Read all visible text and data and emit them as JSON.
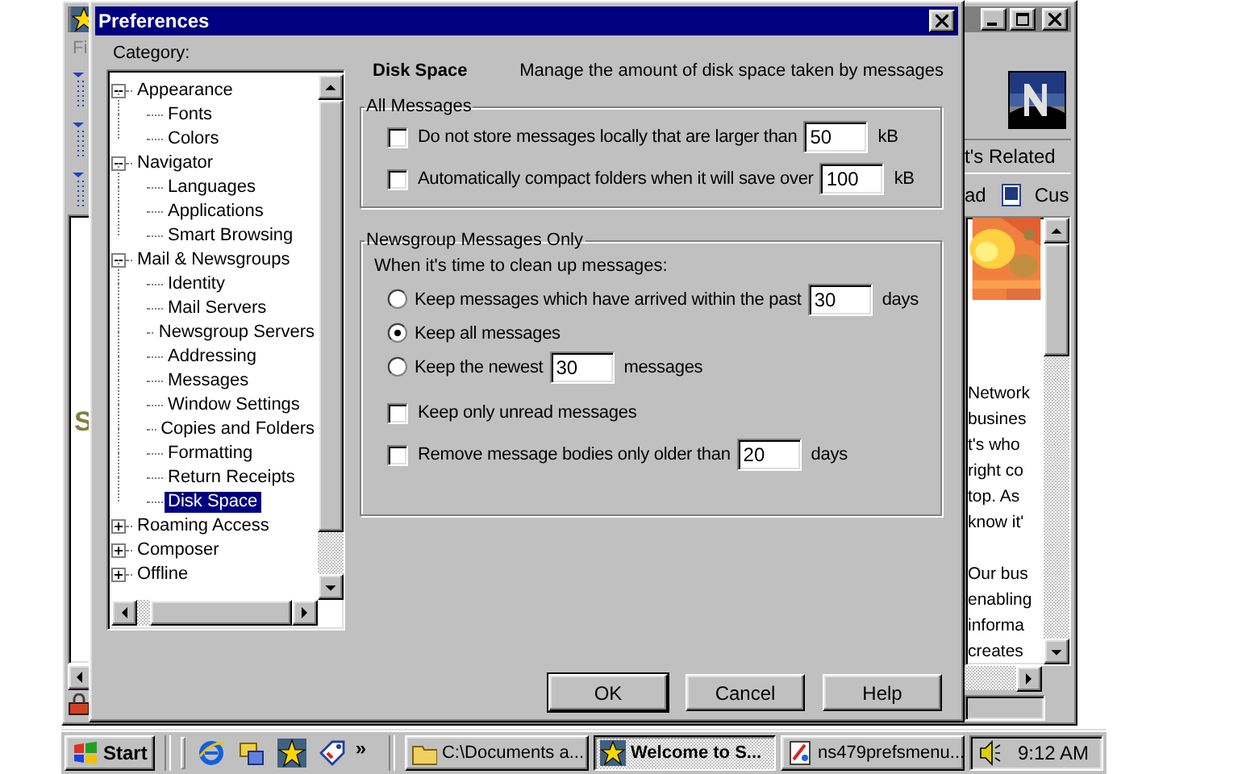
{
  "browser_window": {
    "menu_partial": "Fi",
    "side_letter": "S",
    "links_partial": "t's Related",
    "toolbar_partial": "ad",
    "toolbar_link": "Cus",
    "paragraphs": [
      [
        "Network",
        "busines",
        "t's who",
        "right co",
        "top. As",
        "know it'"
      ],
      [
        "Our bus",
        "enabling",
        "informa",
        "creates"
      ]
    ]
  },
  "dialog": {
    "title": "Preferences",
    "category_label": "Category:",
    "tree": [
      {
        "label": "Appearance",
        "expanded": true,
        "selected": false,
        "children": [
          {
            "label": "Fonts",
            "selected": false
          },
          {
            "label": "Colors",
            "selected": false
          }
        ]
      },
      {
        "label": "Navigator",
        "expanded": true,
        "selected": false,
        "children": [
          {
            "label": "Languages",
            "selected": false
          },
          {
            "label": "Applications",
            "selected": false
          },
          {
            "label": "Smart Browsing",
            "selected": false
          }
        ]
      },
      {
        "label": "Mail & Newsgroups",
        "expanded": true,
        "selected": false,
        "children": [
          {
            "label": "Identity",
            "selected": false
          },
          {
            "label": "Mail Servers",
            "selected": false
          },
          {
            "label": "Newsgroup Servers",
            "selected": false
          },
          {
            "label": "Addressing",
            "selected": false
          },
          {
            "label": "Messages",
            "selected": false
          },
          {
            "label": "Window Settings",
            "selected": false
          },
          {
            "label": "Copies and Folders",
            "selected": false
          },
          {
            "label": "Formatting",
            "selected": false
          },
          {
            "label": "Return Receipts",
            "selected": false
          },
          {
            "label": "Disk Space",
            "selected": true
          }
        ]
      },
      {
        "label": "Roaming Access",
        "expanded": false,
        "selected": false
      },
      {
        "label": "Composer",
        "expanded": false,
        "selected": false
      },
      {
        "label": "Offline",
        "expanded": false,
        "selected": false
      }
    ],
    "panel": {
      "title": "Disk Space",
      "description": "Manage the amount of disk space taken by messages"
    },
    "groups": [
      {
        "title": "All Messages",
        "options": [
          {
            "kind": "checkbox",
            "label": "Do not store messages locally that are larger than",
            "checked": false,
            "value": "50",
            "unit": "kB"
          },
          {
            "kind": "checkbox",
            "label": "Automatically compact folders when it will save over",
            "checked": false,
            "value": "100",
            "unit": "kB"
          }
        ]
      },
      {
        "title": "Newsgroup Messages Only",
        "intro": "When it's time to clean up messages:",
        "options": [
          {
            "kind": "radio",
            "label": "Keep messages which have arrived within the past",
            "selected": false,
            "value": "30",
            "unit": "days"
          },
          {
            "kind": "radio",
            "label": "Keep all messages",
            "selected": true
          },
          {
            "kind": "radio",
            "label": "Keep the newest",
            "selected": false,
            "value": "30",
            "unit": "messages"
          },
          {
            "kind": "checkbox",
            "label": "Keep only unread messages",
            "checked": false
          },
          {
            "kind": "checkbox",
            "label": "Remove message bodies only older than",
            "checked": false,
            "value": "20",
            "unit": "days"
          }
        ]
      }
    ],
    "buttons": [
      {
        "label": "OK",
        "default": true
      },
      {
        "label": "Cancel",
        "default": false
      },
      {
        "label": "Help",
        "default": false
      }
    ]
  },
  "taskbar": {
    "start": "Start",
    "more": "»",
    "tasks": [
      {
        "label": "C:\\Documents a...",
        "active": false
      },
      {
        "label": "Welcome to S...",
        "active": true
      },
      {
        "label": "ns479prefsmenu...",
        "active": false
      }
    ],
    "clock": "9:12 AM"
  }
}
